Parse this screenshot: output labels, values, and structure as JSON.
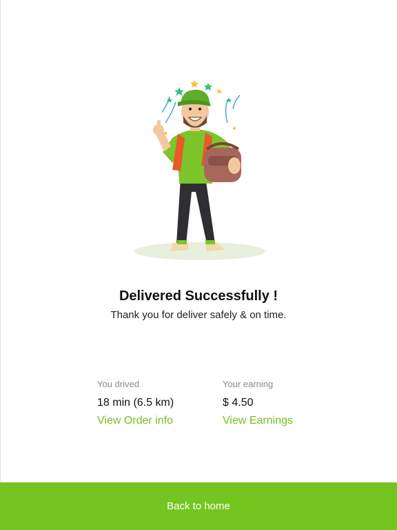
{
  "result": {
    "title": "Delivered Successfully !",
    "subtitle": "Thank you for deliver safely & on time."
  },
  "stats": {
    "drive": {
      "label": "You drived",
      "value": "18 min (6.5 km)",
      "link": "View Order info"
    },
    "earning": {
      "label": "Your earning",
      "value": "$ 4.50",
      "link": "View Earnings"
    }
  },
  "footer": {
    "button_label": "Back to home"
  },
  "colors": {
    "accent": "#75c520",
    "link": "#74c11f",
    "background": "#ffffff"
  },
  "icons": {
    "illustration": "delivery-man-celebrating-illustration"
  }
}
